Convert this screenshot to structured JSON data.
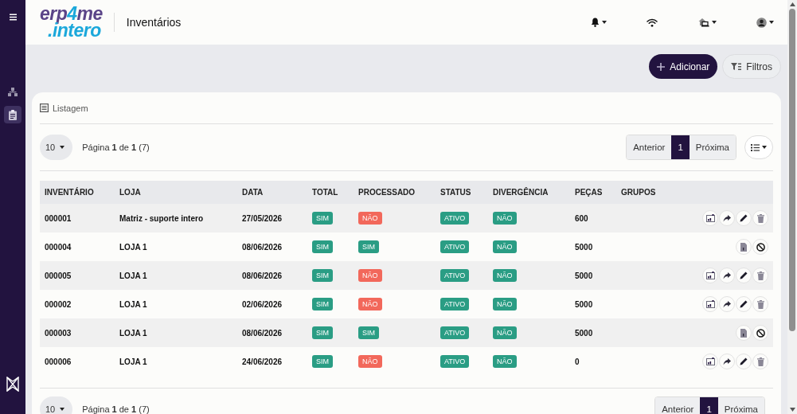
{
  "sidebar": {
    "items": [
      {
        "kind": "hierarchy",
        "selected": false
      },
      {
        "kind": "clipboard",
        "selected": true
      }
    ]
  },
  "header": {
    "logo": {
      "top_parts": [
        "erp",
        "4",
        "me"
      ],
      "bottom": ".intero"
    },
    "title": "Inventários",
    "icons": [
      {
        "kind": "bell",
        "dropdown": true
      },
      {
        "kind": "wifi",
        "dropdown": false
      },
      {
        "kind": "store",
        "dropdown": true
      },
      {
        "kind": "user",
        "dropdown": true
      }
    ]
  },
  "toolbar": {
    "buttons": [
      {
        "kind": "add",
        "label": "Adicionar"
      },
      {
        "kind": "filter",
        "label": "Filtros"
      }
    ]
  },
  "card": {
    "title": "Listagem",
    "pagination_top": {
      "page_size": "10",
      "info": "Página **1** de **1** (7)",
      "previous": "Anterior",
      "page": "1",
      "next": "Próxima"
    },
    "table": {
      "columns": [
        "INVENTÁRIO",
        "LOJA",
        "DATA",
        "TOTAL",
        "PROCESSADO",
        "STATUS",
        "DIVERGÊNCIA",
        "PEÇAS",
        "GRUPOS"
      ],
      "rows": [
        {
          "inventario": "000001",
          "loja": "Matriz - suporte intero",
          "data": "27/05/2026",
          "total": {
            "label": "SIM",
            "color": "#2a9d84"
          },
          "processado": {
            "label": "NÃO",
            "color": "#f2685b"
          },
          "status": {
            "label": "ATIVO",
            "color": "#2a9d84"
          },
          "divergencia": {
            "label": "NÃO",
            "color": "#2a9d84"
          },
          "pecas": "600",
          "actions": [
            {
              "kind": "report"
            },
            {
              "kind": "forward"
            },
            {
              "kind": "edit"
            },
            {
              "kind": "delete"
            }
          ]
        },
        {
          "inventario": "000004",
          "loja": "LOJA 1",
          "data": "08/06/2026",
          "total": {
            "label": "SIM",
            "color": "#2a9d84"
          },
          "processado": {
            "label": "SIM",
            "color": "#2a9d84"
          },
          "status": {
            "label": "ATIVO",
            "color": "#2a9d84"
          },
          "divergencia": {
            "label": "NÃO",
            "color": "#2a9d84"
          },
          "pecas": "5000",
          "actions": [
            {
              "kind": "document"
            },
            {
              "kind": "block"
            }
          ]
        },
        {
          "inventario": "000005",
          "loja": "LOJA 1",
          "data": "08/06/2026",
          "total": {
            "label": "SIM",
            "color": "#2a9d84"
          },
          "processado": {
            "label": "NÃO",
            "color": "#f2685b"
          },
          "status": {
            "label": "ATIVO",
            "color": "#2a9d84"
          },
          "divergencia": {
            "label": "NÃO",
            "color": "#2a9d84"
          },
          "pecas": "5000",
          "actions": [
            {
              "kind": "report"
            },
            {
              "kind": "forward"
            },
            {
              "kind": "edit"
            },
            {
              "kind": "delete"
            }
          ]
        },
        {
          "inventario": "000002",
          "loja": "LOJA 1",
          "data": "02/06/2026",
          "total": {
            "label": "SIM",
            "color": "#2a9d84"
          },
          "processado": {
            "label": "NÃO",
            "color": "#f2685b"
          },
          "status": {
            "label": "ATIVO",
            "color": "#2a9d84"
          },
          "divergencia": {
            "label": "NÃO",
            "color": "#2a9d84"
          },
          "pecas": "5000",
          "actions": [
            {
              "kind": "report"
            },
            {
              "kind": "forward"
            },
            {
              "kind": "edit"
            },
            {
              "kind": "delete"
            }
          ]
        },
        {
          "inventario": "000003",
          "loja": "LOJA 1",
          "data": "08/06/2026",
          "total": {
            "label": "SIM",
            "color": "#2a9d84"
          },
          "processado": {
            "label": "SIM",
            "color": "#2a9d84"
          },
          "status": {
            "label": "ATIVO",
            "color": "#2a9d84"
          },
          "divergencia": {
            "label": "NÃO",
            "color": "#2a9d84"
          },
          "pecas": "5000",
          "actions": [
            {
              "kind": "document"
            },
            {
              "kind": "block"
            }
          ]
        },
        {
          "inventario": "000006",
          "loja": "LOJA 1",
          "data": "24/06/2026",
          "total": {
            "label": "SIM",
            "color": "#2a9d84"
          },
          "processado": {
            "label": "NÃO",
            "color": "#f2685b"
          },
          "status": {
            "label": "ATIVO",
            "color": "#2a9d84"
          },
          "divergencia": {
            "label": "NÃO",
            "color": "#2a9d84"
          },
          "pecas": "0",
          "actions": [
            {
              "kind": "report"
            },
            {
              "kind": "forward"
            },
            {
              "kind": "edit"
            },
            {
              "kind": "delete"
            }
          ]
        }
      ]
    },
    "pagination_bottom": {
      "page_size": "10",
      "info": "Página **1** de **1** (7)",
      "previous": "Anterior",
      "page": "1",
      "next": "Próxima"
    }
  }
}
